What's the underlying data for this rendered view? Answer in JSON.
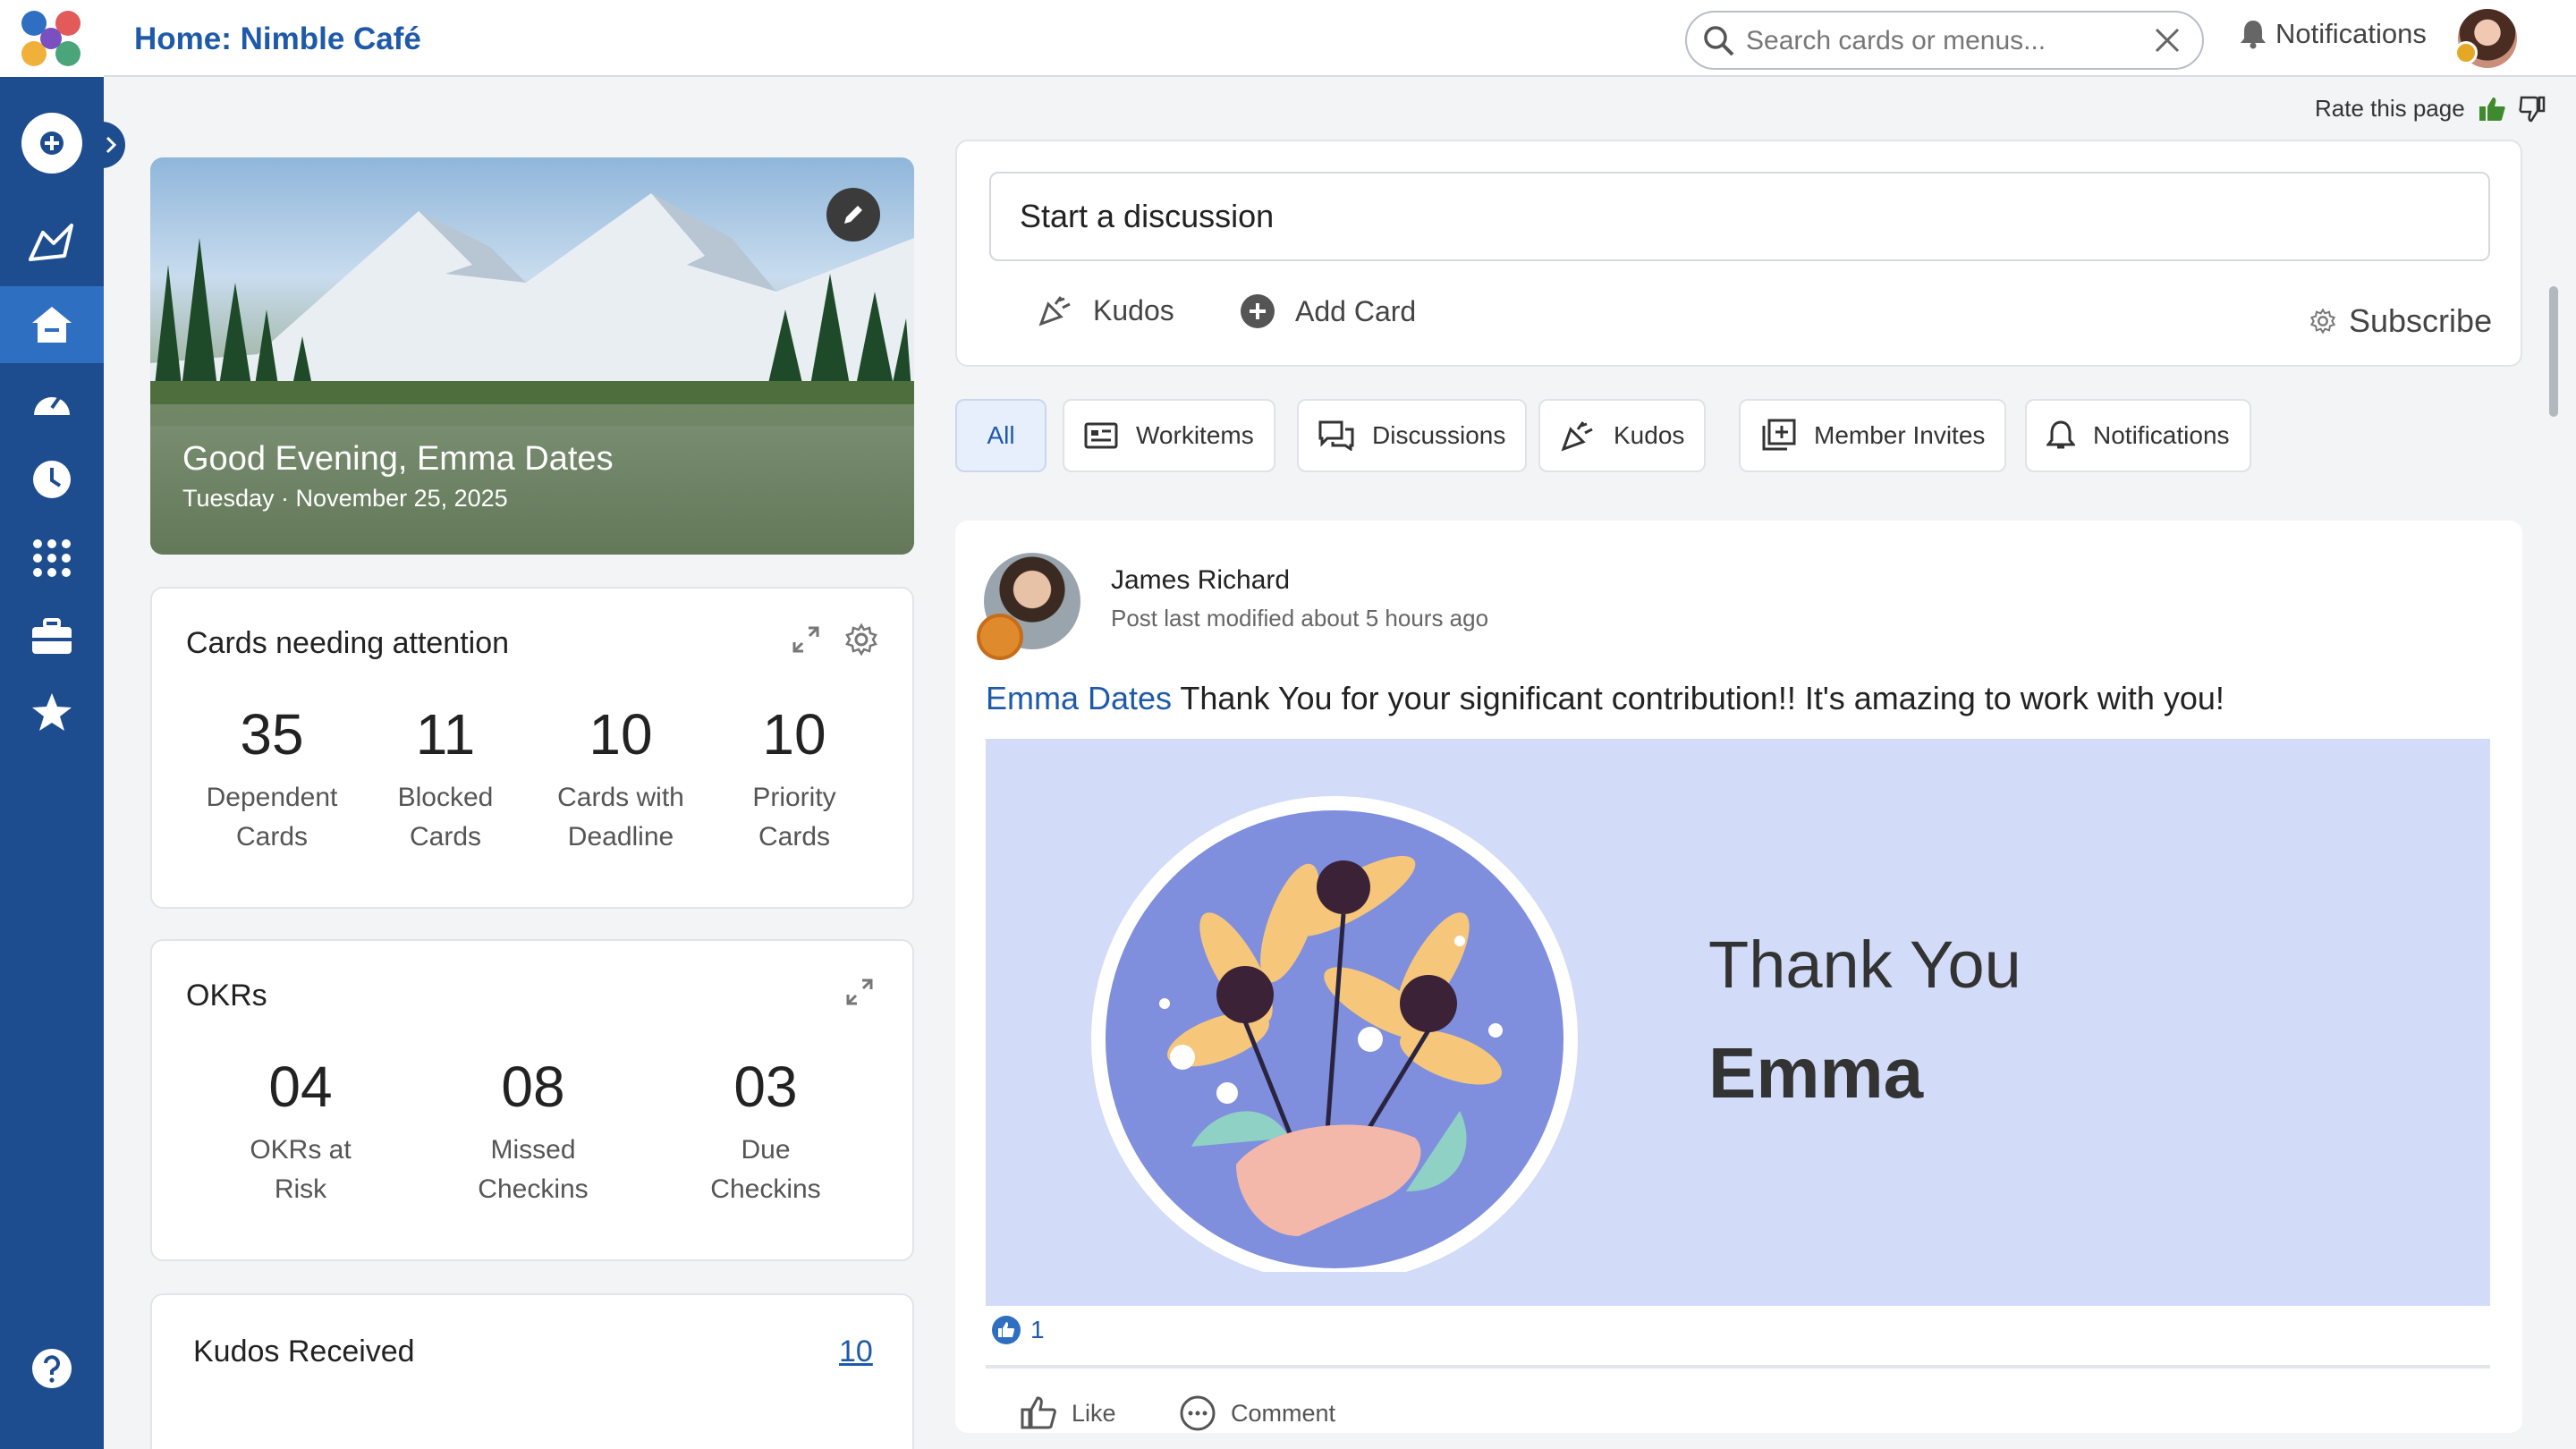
{
  "app": {
    "title": "Home: Nimble Café"
  },
  "search": {
    "placeholder": "Search cards or menus..."
  },
  "header": {
    "notifications_label": "Notifications",
    "rate_label": "Rate this page"
  },
  "sidebar": {
    "items": [
      {
        "icon": "plus-circle-icon"
      },
      {
        "icon": "collaboration-icon"
      },
      {
        "icon": "home-icon",
        "active": true
      },
      {
        "icon": "dashboard-gauge-icon"
      },
      {
        "icon": "clock-icon"
      },
      {
        "icon": "apps-grid-icon"
      },
      {
        "icon": "briefcase-icon"
      },
      {
        "icon": "star-icon"
      },
      {
        "icon": "help-icon"
      }
    ]
  },
  "hero": {
    "greeting": "Good Evening, Emma Dates",
    "date": "Tuesday · November 25, 2025"
  },
  "attention": {
    "title": "Cards needing attention",
    "stats": [
      {
        "value": "35",
        "label_1": "Dependent",
        "label_2": "Cards"
      },
      {
        "value": "11",
        "label_1": "Blocked",
        "label_2": "Cards"
      },
      {
        "value": "10",
        "label_1": "Cards with",
        "label_2": "Deadline"
      },
      {
        "value": "10",
        "label_1": "Priority",
        "label_2": "Cards"
      }
    ]
  },
  "okrs": {
    "title": "OKRs",
    "stats": [
      {
        "value": "04",
        "label_1": "OKRs at",
        "label_2": "Risk"
      },
      {
        "value": "08",
        "label_1": "Missed",
        "label_2": "Checkins"
      },
      {
        "value": "03",
        "label_1": "Due",
        "label_2": "Checkins"
      }
    ]
  },
  "kudos_received": {
    "title": "Kudos Received",
    "count": "10"
  },
  "discussion": {
    "placeholder": "Start a discussion",
    "kudos_label": "Kudos",
    "add_card_label": "Add Card",
    "subscribe_label": "Subscribe"
  },
  "filters": {
    "all": "All",
    "workitems": "Workitems",
    "discussions": "Discussions",
    "kudos": "Kudos",
    "member_invites": "Member Invites",
    "notifications": "Notifications"
  },
  "post": {
    "author": "James Richard",
    "meta": "Post last modified about 5 hours ago",
    "mention": "Emma Dates",
    "text": " Thank You for your significant contribution!! It's amazing to work with you!",
    "image_line1": "Thank You",
    "image_line2": "Emma",
    "reaction_count": "1",
    "like_label": "Like",
    "comment_label": "Comment"
  },
  "colors": {
    "sidebar": "#1e4d8f",
    "accent": "#1e5aa8",
    "card_bg": "#d2dcf8"
  }
}
